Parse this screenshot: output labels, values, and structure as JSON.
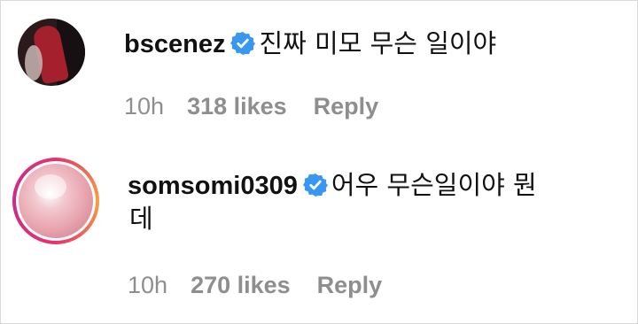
{
  "comments": [
    {
      "username": "bscenez",
      "verified": true,
      "text_line1": "진짜 미모 무슨 일이야",
      "text_line2": "",
      "time": "10h",
      "likes": "318 likes",
      "reply_label": "Reply"
    },
    {
      "username": "somsomi0309",
      "verified": true,
      "text_line1": "어우 무슨일이야 뭔",
      "text_line2": "데",
      "time": "10h",
      "likes": "270 likes",
      "reply_label": "Reply"
    }
  ],
  "colors": {
    "verified_badge": "#3897f0",
    "meta_text": "#8e8e8e",
    "story_ring": "#e7336b"
  },
  "icons": {
    "verified": "verified-badge-icon"
  }
}
